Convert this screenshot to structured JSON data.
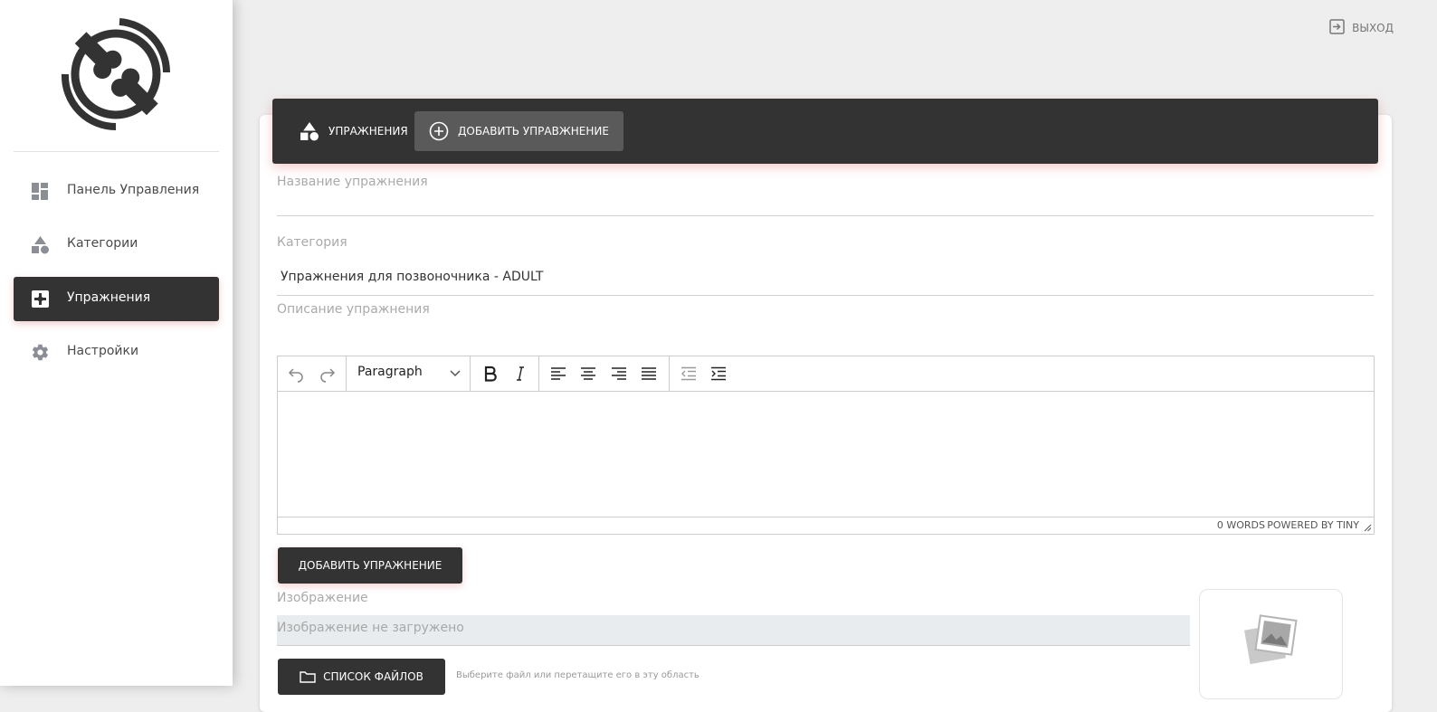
{
  "sidebar": {
    "logo": "joint-logo-icon",
    "items": [
      {
        "label": "Панель Управления",
        "icon": "dashboard-icon",
        "active": false
      },
      {
        "label": "Категории",
        "icon": "shapes-icon",
        "active": false
      },
      {
        "label": "Упражнения",
        "icon": "exercise-icon",
        "active": true
      },
      {
        "label": "Настройки",
        "icon": "gear-icon",
        "active": false
      }
    ]
  },
  "header": {
    "logout_label": "ВЫХОД",
    "logout_icon": "logout-icon"
  },
  "card_header": {
    "tabs": [
      {
        "label": "УПРАЖНЕНИЯ",
        "icon": "shapes-icon"
      },
      {
        "label": "ДОБАВИТЬ УПРАВЖНЕНИЕ",
        "icon": "plus-circle-icon"
      }
    ]
  },
  "form": {
    "name_label": "Название упражнения",
    "name_value": "",
    "category_label": "Категория",
    "category_value": "Упражнения для позвоночника - ADULT",
    "description_label": "Описание упражнения",
    "editor": {
      "block_format": "Paragraph",
      "word_count": "0 WORDS",
      "powered_by": "POWERED BY TINY"
    },
    "submit_label": "ДОБАВИТЬ УПРАЖНЕНИЕ",
    "image_label": "Изображение",
    "image_placeholder": "Изображение не загружено",
    "file_list_label": "СПИСОК ФАЙЛОВ",
    "drop_hint": "Выберите файл или перетащите его в эту область"
  },
  "colors": {
    "dark": "#333333",
    "active_tab": "#5a5a5a",
    "background": "#eeeeee",
    "accent_shadow": "#dc4646"
  }
}
